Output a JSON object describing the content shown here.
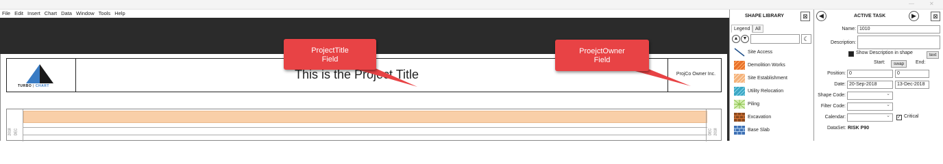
{
  "menu": [
    "File",
    "Edit",
    "Insert",
    "Chart",
    "Data",
    "Window",
    "Tools",
    "Help"
  ],
  "page": {
    "logo_text_a": "TURBO",
    "logo_sep": "|",
    "logo_text_b": "CHART",
    "project_title": "This is the  Project Title",
    "owner": "ProjCo Owner Inc.",
    "left_year": "2018",
    "left_month": "DEC",
    "right_year": "2018",
    "right_month": "DEC"
  },
  "callouts": [
    {
      "line1": "ProjectTitle",
      "line2": "Field"
    },
    {
      "line1": "ProejctOwner",
      "line2": "Field"
    }
  ],
  "shape_library": {
    "title": "SHAPE LIBRARY",
    "close_icon": "⊠",
    "tabs": [
      "Legend",
      "All"
    ],
    "side_icon": "☾",
    "items": [
      {
        "label": "Site Access",
        "icon": "line-icon"
      },
      {
        "label": "Demolition Works",
        "icon": "orange-hatch-icon",
        "color": "#e8702a"
      },
      {
        "label": "Site Establishment",
        "icon": "peach-hatch-icon",
        "color": "#f5b27a"
      },
      {
        "label": "Utility Relocation",
        "icon": "teal-hatch-icon",
        "color": "#3aa7c4"
      },
      {
        "label": "Piling",
        "icon": "green-check-icon",
        "color": "#a6d56a"
      },
      {
        "label": "Excavation",
        "icon": "brown-brick-icon",
        "color": "#8a4a1e"
      },
      {
        "label": "Base Slab",
        "icon": "blue-brick-icon",
        "color": "#3d6fb3"
      }
    ]
  },
  "active_task": {
    "title": "ACTIVE TASK",
    "name_label": "Name:",
    "name_value": "1010",
    "description_label": "Description:",
    "show_desc_label": "Show Description in shape",
    "text_btn": "text",
    "start_label": "Start:",
    "swap_btn": "swap",
    "end_label": "End:",
    "position_label": "Position:",
    "position_start": "0",
    "position_end": "0",
    "date_label": "Date:",
    "date_start": "20-Sep-2018",
    "date_end": "13-Dec-2018",
    "shape_code_label": "Shape Code:",
    "filter_code_label": "Filter Code:",
    "calendar_label": "Calendar:",
    "critical_label": "Critical",
    "dataset_label": "DataSet:",
    "dataset_value": "RISK P90"
  }
}
